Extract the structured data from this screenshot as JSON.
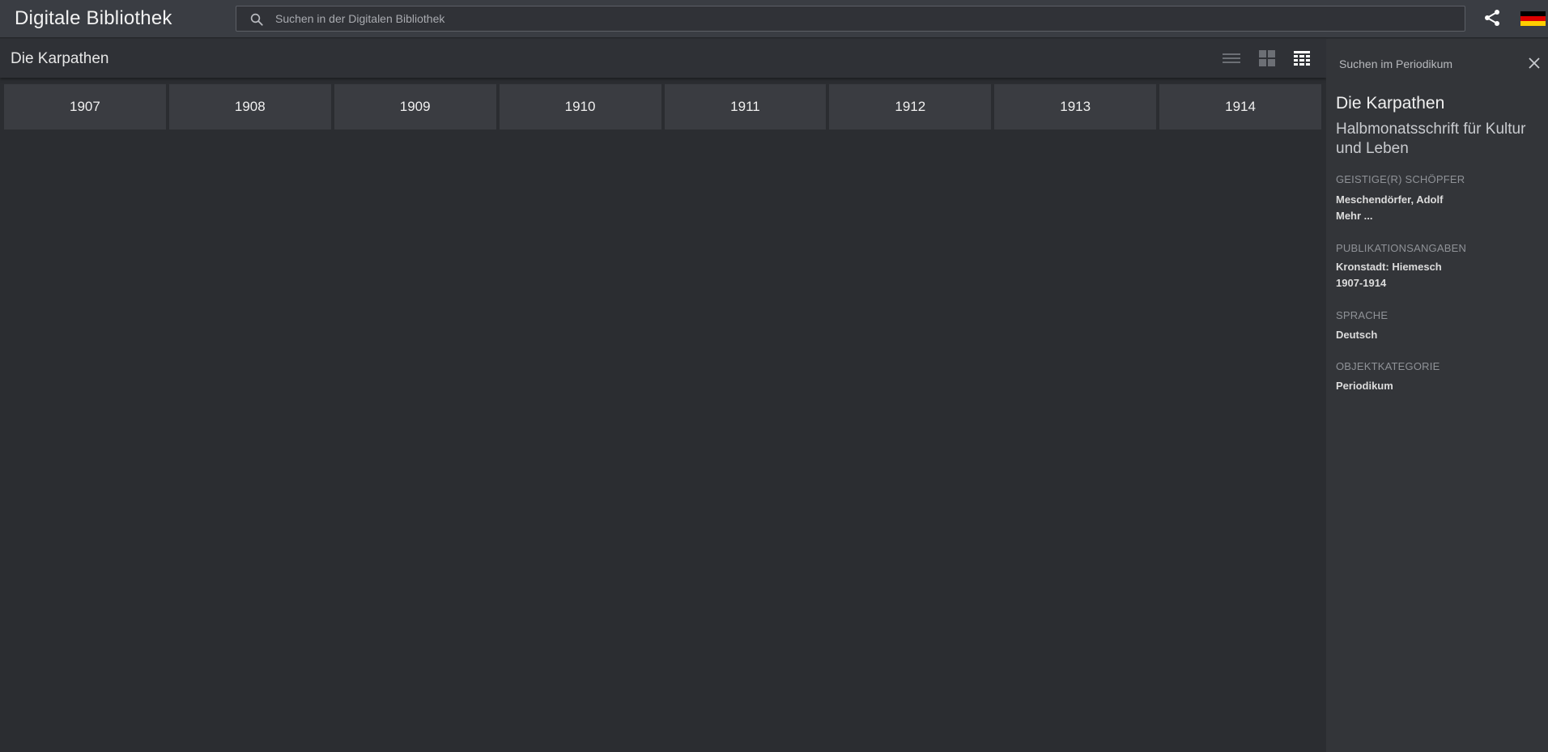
{
  "app": {
    "title": "Digitale Bibliothek"
  },
  "search": {
    "placeholder": "Suchen in der Digitalen Bibliothek"
  },
  "main": {
    "title": "Die Karpathen",
    "years": [
      "1907",
      "1908",
      "1909",
      "1910",
      "1911",
      "1912",
      "1913",
      "1914"
    ]
  },
  "panel": {
    "search_label": "Suchen im Periodikum",
    "title": "Die Karpathen",
    "subtitle": "Halbmonatsschrift für Kultur und Leben",
    "creator_label": "GEISTIGE(R) SCHÖPFER",
    "creator_value": "Meschendörfer, Adolf",
    "more_link": "Mehr ...",
    "publication_label": "PUBLIKATIONSANGABEN",
    "publication_place": "Kronstadt: Hiemesch",
    "publication_years": "1907-1914",
    "language_label": "SPRACHE",
    "language_value": "Deutsch",
    "category_label": "OBJEKTKATEGORIE",
    "category_value": "Periodikum"
  },
  "icons": {
    "search": "search-icon",
    "share": "share-icon",
    "language": "flag-de-icon",
    "view_list": "list-view-icon",
    "view_grid": "grid-view-icon",
    "view_table": "table-view-icon",
    "close": "close-icon"
  },
  "colors": {
    "background": "#2b2d31",
    "topbar": "#3a3d43",
    "tile": "#3a3c41",
    "panel": "#333539",
    "flag_black": "#000000",
    "flag_red": "#dd0000",
    "flag_gold": "#ffce00"
  }
}
